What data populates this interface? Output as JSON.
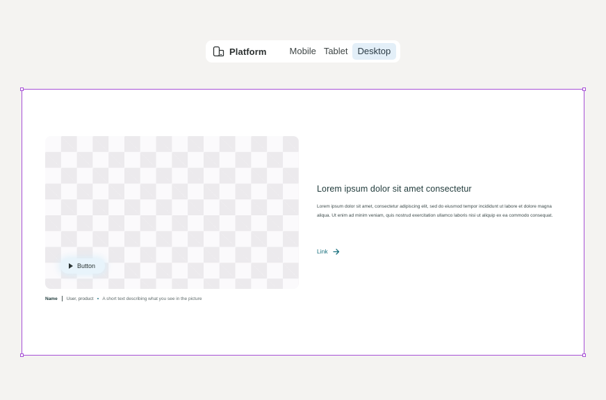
{
  "platform_bar": {
    "label": "Platform",
    "icon": "device-icon",
    "tabs": [
      {
        "label": "Mobile",
        "active": false
      },
      {
        "label": "Tablet",
        "active": false
      },
      {
        "label": "Desktop",
        "active": true
      }
    ]
  },
  "frame": {
    "accent_color": "#a64ed6",
    "media": {
      "button_label": "Button",
      "button_icon": "play-icon"
    },
    "caption": {
      "name": "Name",
      "meta": "User, product",
      "description": "A short text describing what you see in the picture"
    },
    "content": {
      "heading": "Lorem ipsum dolor sit amet consectetur",
      "body": "Lorem ipsum dolor sit amet, consectetur adipiscing elit, sed do eiusmod tempor incididunt ut labore et dolore magna aliqua. Ut enim ad minim veniam, quis nostrud exercitation ullamco laboris nisi ut aliquip ex ea commodo consequat.",
      "link_label": "Link",
      "link_icon": "arrow-right-icon",
      "link_color": "#19707e"
    }
  }
}
